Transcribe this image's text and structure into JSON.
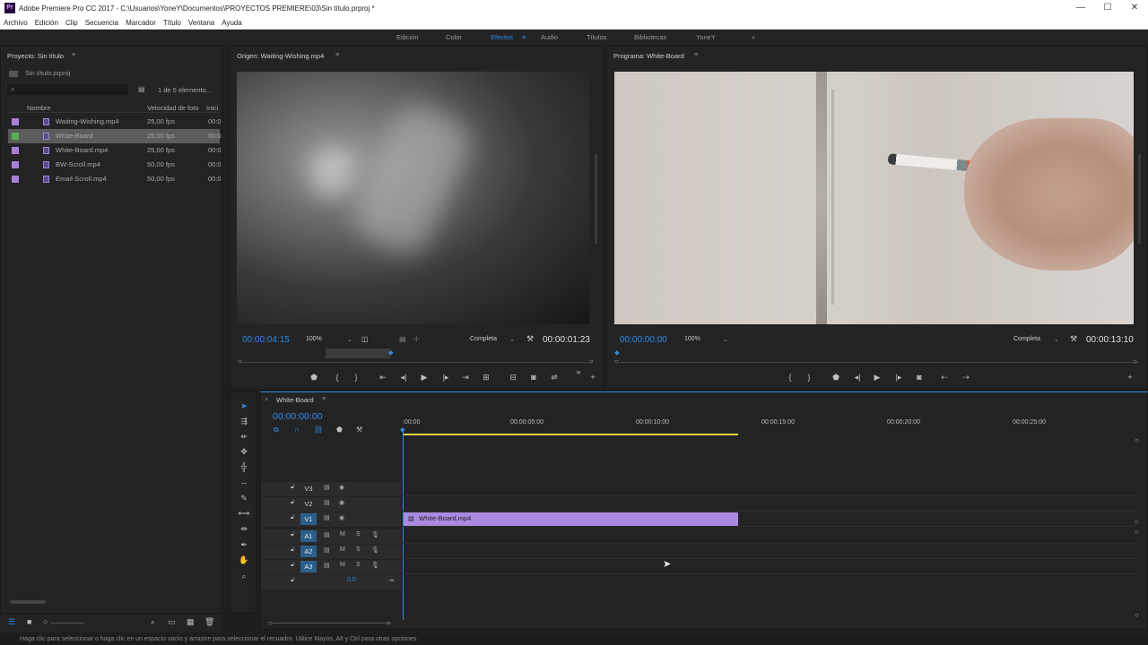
{
  "window": {
    "title": "Adobe Premiere Pro CC 2017 - C:\\Usuarios\\YoneY\\Documentos\\PROYECTOS PREMIERE\\03\\Sin título.prproj *",
    "logo_text": "Pr",
    "controls": [
      "—",
      "☐",
      "✕"
    ]
  },
  "menu": [
    "Archivo",
    "Edición",
    "Clip",
    "Secuencia",
    "Marcador",
    "Título",
    "Ventana",
    "Ayuda"
  ],
  "workspaces": {
    "items": [
      "Edición",
      "Color",
      "Efectos",
      "Audio",
      "Títulos",
      "Bibliotecas",
      "YoneY"
    ],
    "active": "Efectos",
    "more": "»"
  },
  "project": {
    "tab": "Proyecto: Sin título",
    "file": "Sin título.prproj",
    "count": "1 de 5 elemento...",
    "columns": [
      "Nombre",
      "Velocidad de foto",
      "Inici"
    ],
    "items": [
      {
        "name": "Waiting-Wishing.mp4",
        "fps": "25,00 fps",
        "in": "00:0",
        "color": "#a87fd6"
      },
      {
        "name": "White-Board",
        "fps": "25,00 fps",
        "in": "00:0",
        "color": "#55b14d"
      },
      {
        "name": "White-Board.mp4",
        "fps": "25,00 fps",
        "in": "00:0",
        "color": "#a87fd6"
      },
      {
        "name": "BW-Scroll.mp4",
        "fps": "50,00 fps",
        "in": "00:0",
        "color": "#a87fd6"
      },
      {
        "name": "Email-Scroll.mp4",
        "fps": "50,00 fps",
        "in": "00:0",
        "color": "#a87fd6"
      }
    ]
  },
  "source": {
    "tab": "Origen: Waiting-Wishing.mp4",
    "timecode": "00:00:04:15",
    "zoom": "100%",
    "quality": "Completa",
    "duration": "00:00:01:23"
  },
  "program": {
    "tab": "Programa: White-Board",
    "timecode": "00:00:00:00",
    "zoom": "100%",
    "quality": "Completa",
    "duration": "00:00:13:10"
  },
  "timeline": {
    "tab": "White-Board",
    "timecode": "00:00:00:00",
    "ruler": [
      ":00:00",
      "00:00:05:00",
      "00:00:10:00",
      "00:00:15:00",
      "00:00:20:00",
      "00:00:25:00"
    ],
    "video_tracks": [
      "V3",
      "V2",
      "V1"
    ],
    "audio_tracks": [
      "A1",
      "A2",
      "A3"
    ],
    "master_value": "0,0",
    "clip": "White-Board.mp4",
    "accent": "#a98ae0"
  },
  "status": "Haga clic para seleccionar o haga clic en un espacio vacío y arrastre para seleccionar el recuadro. Utilice Mayús, Alt y Ctrl para otras opciones."
}
